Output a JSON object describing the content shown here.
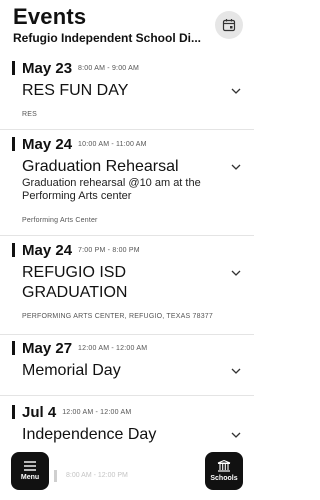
{
  "header": {
    "title": "Events",
    "subtitle": "Refugio Independent School Di..."
  },
  "events": [
    {
      "date": "May 23",
      "time": "8:00 AM - 9:00 AM",
      "title": "RES FUN DAY",
      "description": "",
      "location": "RES"
    },
    {
      "date": "May 24",
      "time": "10:00 AM - 11:00 AM",
      "title": "Graduation Rehearsal",
      "description": "Graduation rehearsal @10 am at the Performing Arts center",
      "location": "Performing Arts Center"
    },
    {
      "date": "May 24",
      "time": "7:00 PM - 8:00 PM",
      "title": "REFUGIO ISD GRADUATION",
      "description": "",
      "location": "PERFORMING ARTS CENTER, REFUGIO, TEXAS 78377"
    },
    {
      "date": "May 27",
      "time": "12:00 AM - 12:00 AM",
      "title": "Memorial Day",
      "description": "",
      "location": ""
    },
    {
      "date": "Jul 4",
      "time": "12:00 AM - 12:00 AM",
      "title": "Independence Day",
      "description": "",
      "location": ""
    }
  ],
  "partial_next_time": "8:00 AM - 12:00 PM",
  "bottom_nav": {
    "menu_label": "Menu",
    "schools_label": "Schools"
  },
  "colors": {
    "accent": "#111111",
    "calendar_button_bg": "#e6e6e6",
    "divider": "#e4e4e4"
  }
}
